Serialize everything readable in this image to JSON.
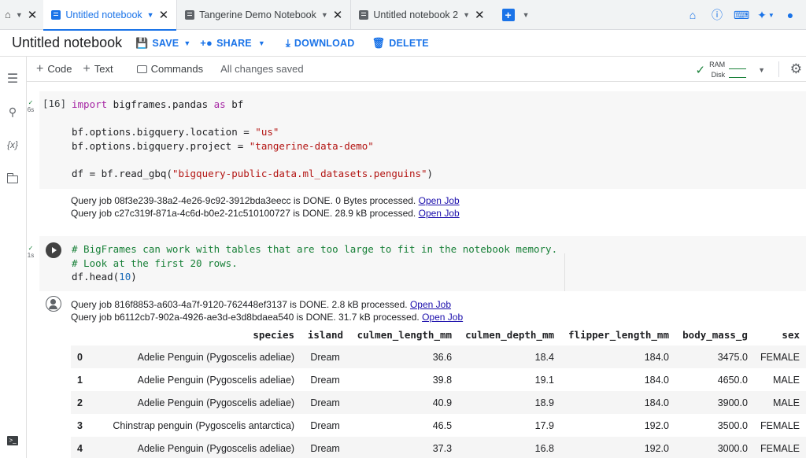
{
  "tabs": [
    {
      "label": "Untitled notebook",
      "active": true
    },
    {
      "label": "Tangerine Demo Notebook",
      "active": false
    },
    {
      "label": "Untitled notebook 2",
      "active": false
    }
  ],
  "header": {
    "title": "Untitled notebook",
    "save": "SAVE",
    "share": "SHARE",
    "download": "DOWNLOAD",
    "delete": "DELETE"
  },
  "toolbar": {
    "code": "Code",
    "text": "Text",
    "commands": "Commands",
    "status": "All changes saved",
    "ram": "RAM",
    "disk": "Disk"
  },
  "cell1": {
    "exec_count": "[16]",
    "duration": "6s",
    "output": [
      {
        "text": "Query job 08f3e239-38a2-4e26-9c92-3912bda3eecc is DONE. 0 Bytes processed.",
        "link": "Open Job"
      },
      {
        "text": "Query job c27c319f-871a-4c6d-b0e2-21c510100727 is DONE. 28.9 kB processed.",
        "link": "Open Job"
      }
    ]
  },
  "cell2": {
    "duration": "1s",
    "output": [
      {
        "text": "Query job 816f8853-a603-4a7f-9120-762448ef3137 is DONE. 2.8 kB processed.",
        "link": "Open Job"
      },
      {
        "text": "Query job b6112cb7-902a-4926-ae3d-e3d8bdaea540 is DONE. 31.7 kB processed.",
        "link": "Open Job"
      }
    ]
  },
  "table": {
    "columns": [
      "species",
      "island",
      "culmen_length_mm",
      "culmen_depth_mm",
      "flipper_length_mm",
      "body_mass_g",
      "sex"
    ],
    "rows": [
      [
        "0",
        "Adelie Penguin (Pygoscelis adeliae)",
        "Dream",
        "36.6",
        "18.4",
        "184.0",
        "3475.0",
        "FEMALE"
      ],
      [
        "1",
        "Adelie Penguin (Pygoscelis adeliae)",
        "Dream",
        "39.8",
        "19.1",
        "184.0",
        "4650.0",
        "MALE"
      ],
      [
        "2",
        "Adelie Penguin (Pygoscelis adeliae)",
        "Dream",
        "40.9",
        "18.9",
        "184.0",
        "3900.0",
        "MALE"
      ],
      [
        "3",
        "Chinstrap penguin (Pygoscelis antarctica)",
        "Dream",
        "46.5",
        "17.9",
        "192.0",
        "3500.0",
        "FEMALE"
      ],
      [
        "4",
        "Adelie Penguin (Pygoscelis adeliae)",
        "Dream",
        "37.3",
        "16.8",
        "192.0",
        "3000.0",
        "FEMALE"
      ]
    ]
  },
  "colors": {
    "accent": "#1a73e8",
    "success": "#188038",
    "keyword": "#a626a4",
    "string": "#b31412",
    "comment": "#188038"
  }
}
